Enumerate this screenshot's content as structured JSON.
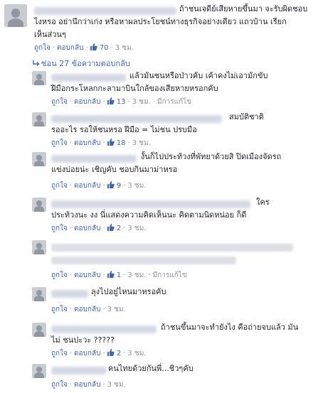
{
  "thread": {
    "replies_toggle": "ซ่อน 27 ข้อความตอบกลับ",
    "comments": [
      {
        "lines": [
          "ถ้าชนเจดีย์เสียหายขึ้นมา จะรับผิดชอบ",
          "ไงหรอ อย่านึกว่าเก่ง หรือหาผลประโยชน์ทางธุรกิจอย่างเดียว แถวบ้าน เรียก",
          "เห็นส่วนๆ"
        ],
        "like": "ถูกใจ",
        "reply": "ตอบกลับ",
        "likes": "70",
        "time": "3 ชม."
      },
      {
        "lines": [
          "แล้วมันชนหรือป่าวคับ เค้าคงไม่เอามักขับ",
          "ฝีมือกระโหลกกะลามาบินใกล้ของเสียหายหรอกคับ"
        ],
        "like": "ถูกใจ",
        "reply": "ตอบกลับ",
        "likes": "13",
        "time": "3 ชม.",
        "edited": "มีการแก้ไข"
      },
      {
        "lines": [
          "สมบัติชาติ",
          "รออะไร รอให้ชนหรอ ฝีมือ = ไม่ชน ปรบมือ"
        ],
        "like": "ถูกใจ",
        "reply": "ตอบกลับ",
        "likes": "18",
        "time": "3 ชม."
      },
      {
        "lines": [
          "งั้นก็ไปประท้วงที่พัทยาด้วยสิ ปิดเมืองจัดรถ",
          "แข่งบ่อยน่ะ เชิญคับ ชอบกินมาม่าหรอ"
        ],
        "like": "ถูกใจ",
        "reply": "ตอบกลับ",
        "likes": "9",
        "time": "3 ชม."
      },
      {
        "lines": [
          "ใคร",
          "ประท้วงนะ งง นี่แสดงความคิดเห็นนะ คิดตามนิดหน่อย ก็ดี"
        ],
        "like": "ถูกใจ",
        "reply": "ตอบกลับ",
        "likes": "2",
        "time": "3 ชม."
      },
      {
        "lines": [],
        "like": "ถูกใจ",
        "reply": "ตอบกลับ",
        "likes": "1",
        "time": "3 ชม.",
        "edited": "มีการแก้ไข"
      },
      {
        "lines": [
          "ลุงไปอยู่ไหนมาหรอคับ"
        ],
        "like": "ถูกใจ",
        "reply": "ตอบกลับ",
        "time": "3 ชม."
      },
      {
        "lines": [
          "ถ้าชนขึ้นมาจะทำยังไง คือถ่ายจบแล้ว มัน",
          "ไม่ ชนปะวะ ?????"
        ],
        "like": "ถูกใจ",
        "reply": "ตอบกลับ",
        "likes": "2",
        "time": "3 ชม."
      },
      {
        "lines": [
          "คนไทยด้วยกันพี่...ชิวๆคับ"
        ],
        "like": "ถูกใจ",
        "reply": "ตอบกลับ",
        "time": "3 ชม."
      }
    ]
  }
}
